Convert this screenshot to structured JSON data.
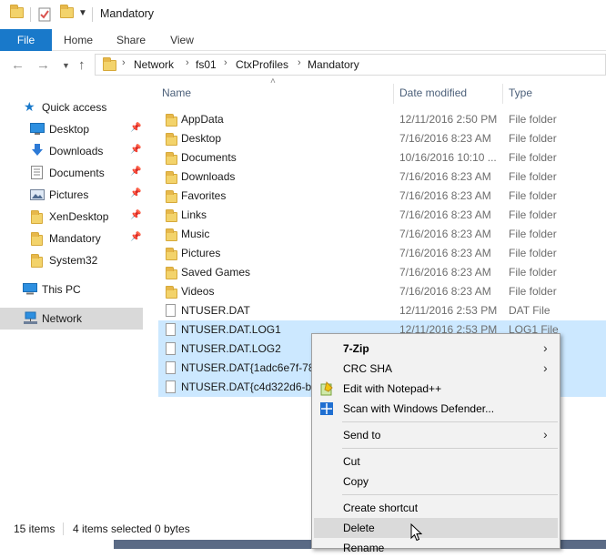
{
  "window": {
    "title": "Mandatory"
  },
  "ribbon": {
    "tabs": [
      "File",
      "Home",
      "Share",
      "View"
    ]
  },
  "address": {
    "crumbs": [
      "Network",
      "fs01",
      "CtxProfiles",
      "Mandatory"
    ]
  },
  "nav": {
    "quick_access": "Quick access",
    "items": [
      {
        "label": "Desktop",
        "icon": "desktop-icon",
        "pinned": true
      },
      {
        "label": "Downloads",
        "icon": "downloads-icon",
        "pinned": true
      },
      {
        "label": "Documents",
        "icon": "documents-icon",
        "pinned": true
      },
      {
        "label": "Pictures",
        "icon": "pictures-icon",
        "pinned": true
      },
      {
        "label": "XenDesktop",
        "icon": "folder-icon",
        "pinned": true
      },
      {
        "label": "Mandatory",
        "icon": "folder-icon",
        "pinned": true
      },
      {
        "label": "System32",
        "icon": "folder-icon",
        "pinned": false
      }
    ],
    "this_pc": "This PC",
    "network": "Network"
  },
  "columns": {
    "name": "Name",
    "date": "Date modified",
    "type": "Type"
  },
  "files": [
    {
      "name": "AppData",
      "date": "12/11/2016 2:50 PM",
      "type": "File folder",
      "kind": "folder",
      "selected": false
    },
    {
      "name": "Desktop",
      "date": "7/16/2016 8:23 AM",
      "type": "File folder",
      "kind": "folder",
      "selected": false
    },
    {
      "name": "Documents",
      "date": "10/16/2016 10:10 ...",
      "type": "File folder",
      "kind": "folder",
      "selected": false
    },
    {
      "name": "Downloads",
      "date": "7/16/2016 8:23 AM",
      "type": "File folder",
      "kind": "folder",
      "selected": false
    },
    {
      "name": "Favorites",
      "date": "7/16/2016 8:23 AM",
      "type": "File folder",
      "kind": "folder",
      "selected": false
    },
    {
      "name": "Links",
      "date": "7/16/2016 8:23 AM",
      "type": "File folder",
      "kind": "folder",
      "selected": false
    },
    {
      "name": "Music",
      "date": "7/16/2016 8:23 AM",
      "type": "File folder",
      "kind": "folder",
      "selected": false
    },
    {
      "name": "Pictures",
      "date": "7/16/2016 8:23 AM",
      "type": "File folder",
      "kind": "folder",
      "selected": false
    },
    {
      "name": "Saved Games",
      "date": "7/16/2016 8:23 AM",
      "type": "File folder",
      "kind": "folder",
      "selected": false
    },
    {
      "name": "Videos",
      "date": "7/16/2016 8:23 AM",
      "type": "File folder",
      "kind": "folder",
      "selected": false
    },
    {
      "name": "NTUSER.DAT",
      "date": "12/11/2016 2:53 PM",
      "type": "DAT File",
      "kind": "file",
      "selected": false
    },
    {
      "name": "NTUSER.DAT.LOG1",
      "date": "12/11/2016 2:53 PM",
      "type": "LOG1 File",
      "kind": "file",
      "selected": true
    },
    {
      "name": "NTUSER.DAT.LOG2",
      "date": "",
      "type": "",
      "kind": "file",
      "selected": true
    },
    {
      "name": "NTUSER.DAT{1adc6e7f-78e",
      "date": "",
      "type": "",
      "kind": "file",
      "selected": true
    },
    {
      "name": "NTUSER.DAT{c4d322d6-bfe",
      "date": "",
      "type": "",
      "kind": "file",
      "selected": true
    }
  ],
  "status": {
    "items": "15 items",
    "selected": "4 items selected",
    "size": "0 bytes"
  },
  "context_menu": {
    "items": [
      {
        "label": "7-Zip",
        "submenu": true,
        "bold": true
      },
      {
        "label": "CRC SHA",
        "submenu": true
      },
      {
        "label": "Edit with Notepad++",
        "icon": "notepadpp-icon"
      },
      {
        "label": "Scan with Windows Defender...",
        "icon": "defender-icon"
      },
      {
        "label": "Send to",
        "submenu": true
      },
      {
        "label": "Cut"
      },
      {
        "label": "Copy"
      },
      {
        "label": "Create shortcut"
      },
      {
        "label": "Delete",
        "hover": true
      },
      {
        "label": "Rename"
      }
    ]
  },
  "colors": {
    "accent": "#1979ca",
    "selection": "#cce8ff",
    "folder": "#f3d36b"
  }
}
